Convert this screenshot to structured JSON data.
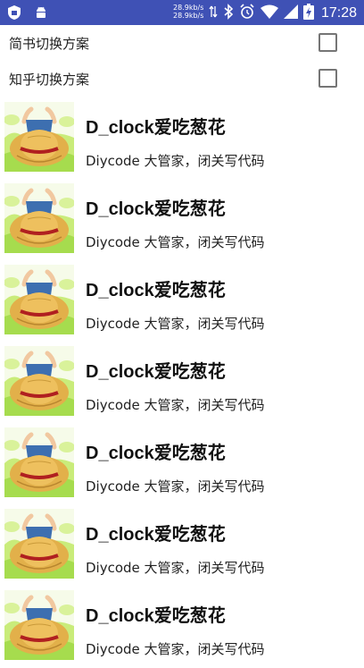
{
  "status_bar": {
    "net_speed_up": "28.9kb/s",
    "net_speed_down": "28.9kb/s",
    "time": "17:28",
    "background": "#3f51b5",
    "icons": [
      "shield-icon",
      "android-icon",
      "bluetooth-icon",
      "alarm-icon",
      "wifi-icon",
      "signal-icon",
      "battery-charging-icon"
    ]
  },
  "settings": [
    {
      "label": "简书切换方案",
      "checked": false
    },
    {
      "label": "知乎切换方案",
      "checked": false
    }
  ],
  "list": {
    "items": [
      {
        "title": "D_clock爱吃葱花",
        "subtitle": "Diycode 大管家，闭关写代码"
      },
      {
        "title": "D_clock爱吃葱花",
        "subtitle": "Diycode 大管家，闭关写代码"
      },
      {
        "title": "D_clock爱吃葱花",
        "subtitle": "Diycode 大管家，闭关写代码"
      },
      {
        "title": "D_clock爱吃葱花",
        "subtitle": "Diycode 大管家，闭关写代码"
      },
      {
        "title": "D_clock爱吃葱花",
        "subtitle": "Diycode 大管家，闭关写代码"
      },
      {
        "title": "D_clock爱吃葱花",
        "subtitle": "Diycode 大管家，闭关写代码"
      },
      {
        "title": "D_clock爱吃葱花",
        "subtitle": "Diycode 大管家，闭关写代码"
      }
    ]
  }
}
